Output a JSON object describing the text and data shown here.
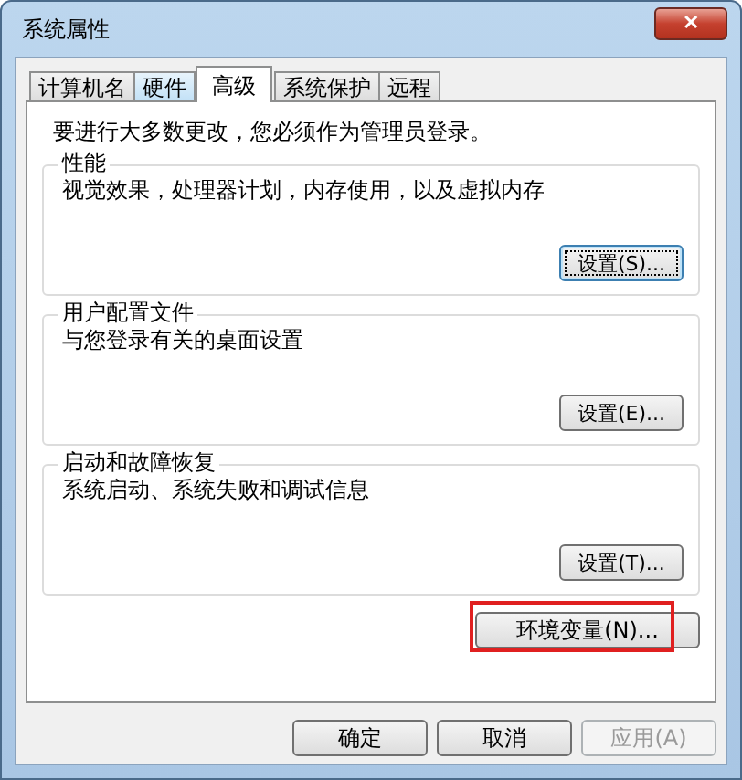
{
  "window": {
    "title": "系统属性",
    "close": "✕"
  },
  "tabs": [
    {
      "label": "计算机名",
      "selected": false,
      "hovered": false
    },
    {
      "label": "硬件",
      "selected": false,
      "hovered": true
    },
    {
      "label": "高级",
      "selected": true,
      "hovered": false
    },
    {
      "label": "系统保护",
      "selected": false,
      "hovered": false
    },
    {
      "label": "远程",
      "selected": false,
      "hovered": false
    }
  ],
  "notice": "要进行大多数更改，您必须作为管理员登录。",
  "groups": [
    {
      "title": "性能",
      "description": "视觉效果，处理器计划，内存使用，以及虚拟内存",
      "button": {
        "label": "设置(S)...",
        "focused": true
      }
    },
    {
      "title": "用户配置文件",
      "description": "与您登录有关的桌面设置",
      "button": {
        "label": "设置(E)...",
        "focused": false
      }
    },
    {
      "title": "启动和故障恢复",
      "description": "系统启动、系统失败和调试信息",
      "button": {
        "label": "设置(T)...",
        "focused": false
      }
    }
  ],
  "env_button": {
    "label": "环境变量(N)...",
    "highlighted": true
  },
  "buttons": [
    {
      "label": "确定",
      "disabled": false
    },
    {
      "label": "取消",
      "disabled": false
    },
    {
      "label": "应用(A)",
      "disabled": true
    }
  ]
}
